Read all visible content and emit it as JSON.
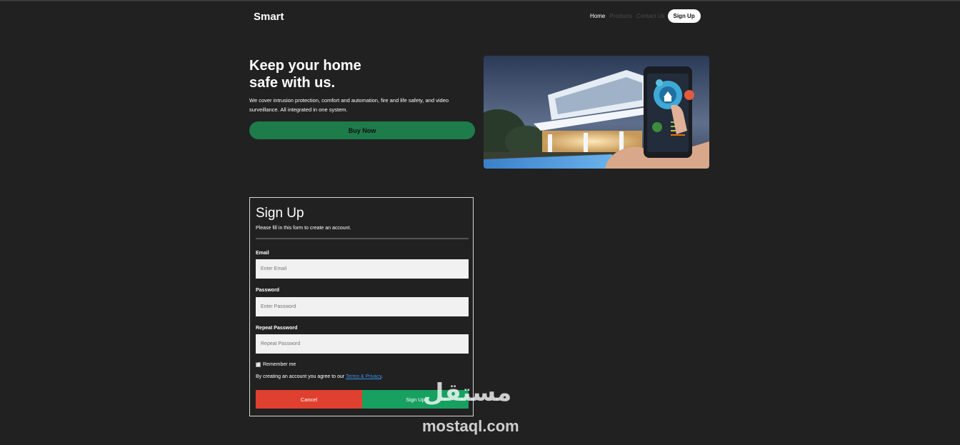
{
  "nav": {
    "brand": "Smart",
    "links": [
      {
        "label": "Home",
        "active": true
      },
      {
        "label": "Products",
        "active": false
      },
      {
        "label": "Contact Us",
        "active": false
      }
    ],
    "signup_label": "Sign Up"
  },
  "hero": {
    "title_line1": "Keep your home",
    "title_line2": "safe with us.",
    "description": "We cover intrusion protection, comfort and automation, fire and life safety, and video surveillance. All integrated in one system.",
    "buy_label": "Buy Now",
    "buy_color": "#1e7b4a"
  },
  "form": {
    "title": "Sign Up",
    "subtitle": "Please fill in this form to create an account.",
    "email": {
      "label": "Email",
      "placeholder": "Enter Email",
      "value": ""
    },
    "password": {
      "label": "Password",
      "placeholder": "Enter Password",
      "value": ""
    },
    "repeat": {
      "label": "Repeat Password",
      "placeholder": "Repeat Password",
      "value": ""
    },
    "remember_label": "Remember me",
    "remember_checked": true,
    "terms_prefix": "By creating an account you agree to our ",
    "terms_link": "Terms & Privacy",
    "terms_suffix": ".",
    "cancel_label": "Cancel",
    "submit_label": "Sign Up",
    "cancel_color": "#e0402f",
    "submit_color": "#17a060"
  },
  "watermark": {
    "arabic": "مستقل",
    "latin": "mostaql.com"
  }
}
